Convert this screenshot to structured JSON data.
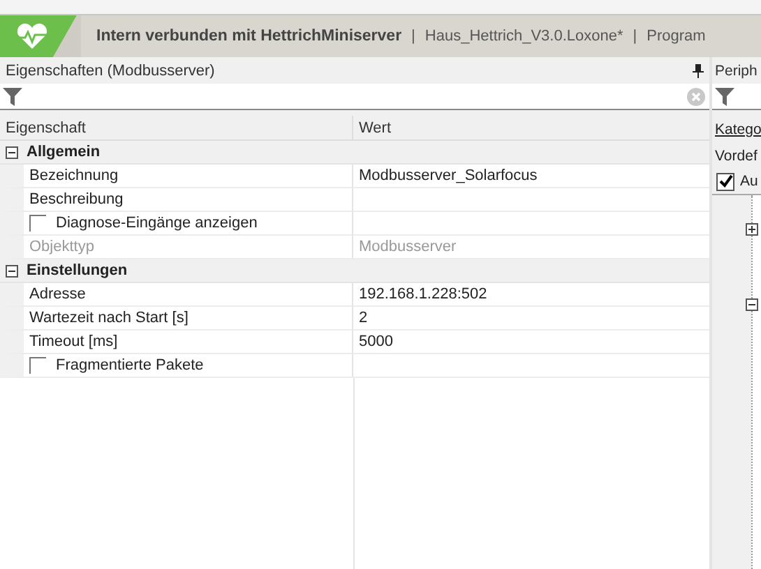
{
  "header": {
    "title": "Intern verbunden mit HettrichMiniserver",
    "separator_1": "|",
    "project": "Haus_Hettrich_V3.0.Loxone*",
    "separator_2": "|",
    "next": "Program"
  },
  "properties_panel": {
    "title": "Eigenschaften (Modbusserver)",
    "columns": [
      "Eigenschaft",
      "Wert"
    ],
    "groups": [
      {
        "label": "Allgemein",
        "expanded": true,
        "rows": [
          {
            "kind": "text",
            "name": "Bezeichnung",
            "value": "Modbusserver_Solarfocus",
            "disabled": false
          },
          {
            "kind": "text",
            "name": "Beschreibung",
            "disabled": false
          },
          {
            "kind": "checkbox",
            "name": "Diagnose-Eingänge anzeigen",
            "checked": false,
            "disabled": false
          },
          {
            "kind": "text",
            "name": "Objekttyp",
            "value": "Modbusserver",
            "disabled": true
          }
        ]
      },
      {
        "label": "Einstellungen",
        "expanded": true,
        "rows": [
          {
            "kind": "text",
            "name": "Adresse",
            "value": "192.168.1.228:502",
            "disabled": false
          },
          {
            "kind": "text",
            "name": "Wartezeit nach Start [s]",
            "value": "2",
            "disabled": false
          },
          {
            "kind": "text",
            "name": "Timeout [ms]",
            "value": "5000",
            "disabled": false
          },
          {
            "kind": "checkbox",
            "name": "Fragmentierte Pakete",
            "checked": false,
            "disabled": false
          }
        ]
      }
    ]
  },
  "peripherie_panel": {
    "title": "Periph",
    "category_label": "Katego",
    "preset_label": "Vordef",
    "auto_checkbox": {
      "label": "Au",
      "checked": true
    },
    "tree_nodes": [
      {
        "expanded": false
      },
      {
        "expanded": true
      }
    ]
  }
}
